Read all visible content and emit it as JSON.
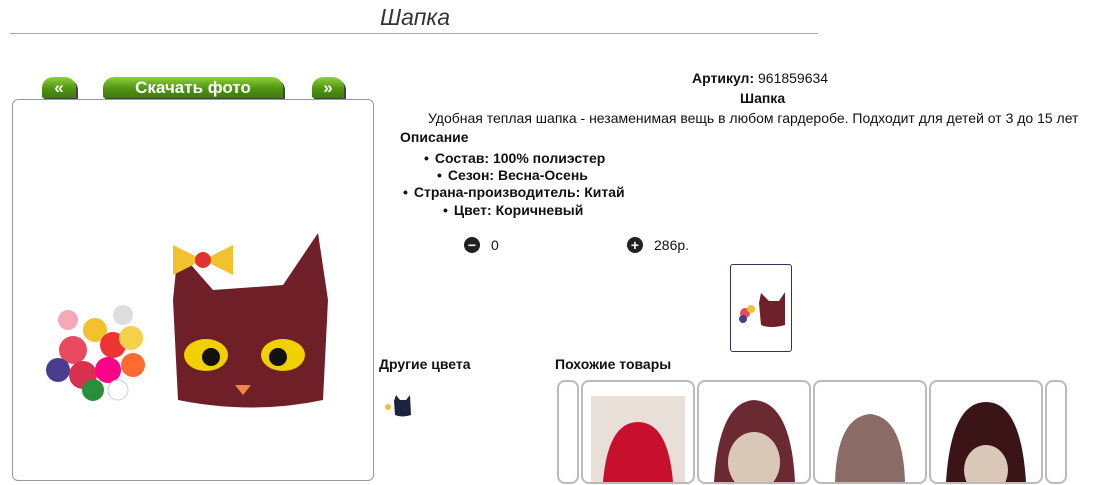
{
  "page": {
    "title": "Шапка"
  },
  "nav": {
    "prev_label": "«",
    "download_label": "Скачать фото",
    "next_label": "»"
  },
  "product": {
    "article_label": "Артикул:",
    "article_value": "961859634",
    "name": "Шапка",
    "description": "Удобная теплая шапка - незаменимая вещь в любом гардеробе. Подходит для детей от 3 до 15 лет",
    "description_heading": "Описание",
    "specs": [
      "Состав: 100% полиэстер",
      "Сезон: Весна-Осень",
      "Страна-производитель: Китай",
      "Цвет: Коричневый"
    ],
    "quantity": "0",
    "price": "286р."
  },
  "icons": {
    "minus": "minus-circle-icon",
    "plus": "plus-circle-icon"
  },
  "colors": {
    "accent_green": "#4f9412",
    "hat_color": "#6e1f28"
  },
  "sections": {
    "other_colors": "Другие цвета",
    "similar": "Похожие товары"
  }
}
